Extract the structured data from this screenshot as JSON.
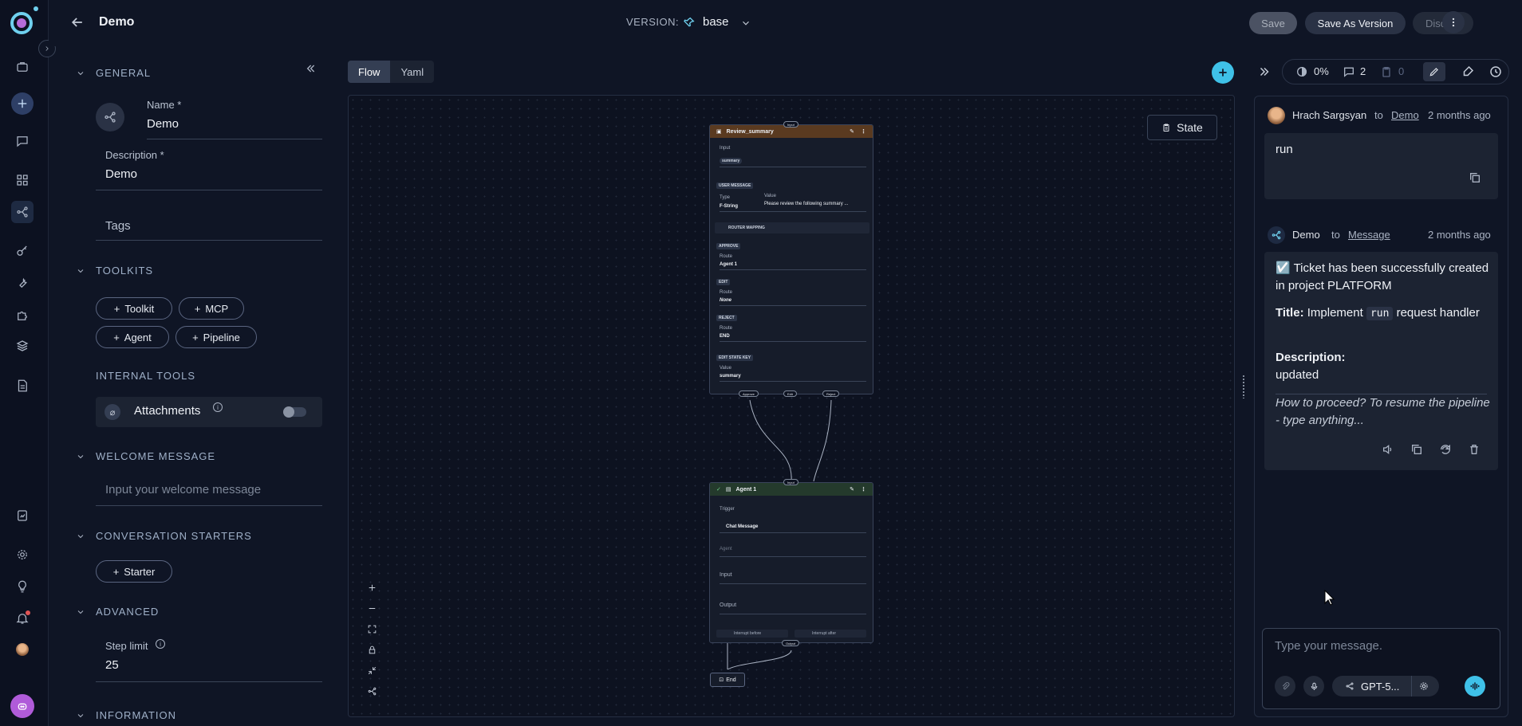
{
  "header": {
    "title": "Demo",
    "version_label": "VERSION:",
    "version_value": "base",
    "save_label": "Save",
    "save_as_version_label": "Save As Version",
    "discard_label": "Discard"
  },
  "left_panel": {
    "general": {
      "heading": "GENERAL",
      "name_label": "Name *",
      "name_value": "Demo",
      "description_label": "Description *",
      "description_value": "Demo",
      "tags_placeholder": "Tags"
    },
    "toolkits": {
      "heading": "TOOLKITS",
      "buttons": [
        "Toolkit",
        "MCP",
        "Agent",
        "Pipeline"
      ]
    },
    "internal_tools": {
      "heading": "INTERNAL TOOLS",
      "attachments_label": "Attachments",
      "attachments_enabled": false
    },
    "welcome_message": {
      "heading": "WELCOME MESSAGE",
      "placeholder": "Input your welcome message"
    },
    "conversation_starters": {
      "heading": "CONVERSATION STARTERS",
      "button": "Starter"
    },
    "advanced": {
      "heading": "ADVANCED",
      "step_limit_label": "Step limit",
      "step_limit_value": "25"
    },
    "information": {
      "heading": "INFORMATION"
    }
  },
  "canvas": {
    "tabs": [
      "Flow",
      "Yaml"
    ],
    "active_tab": "Flow",
    "state_button": "State",
    "nodes": {
      "review": {
        "title": "Review_summary",
        "input_port": "Input",
        "input_label": "Input",
        "input_chip": "summary",
        "user_message_badge": "USER MESSAGE",
        "type_label": "Type",
        "type_value": "F-String",
        "value_label": "Value",
        "value_text": "Please review the following summary ...",
        "router_mapping": "ROUTER MAPPING",
        "approve_badge": "APPROVE",
        "approve_route_label": "Route",
        "approve_route": "Agent 1",
        "edit_badge": "EDIT",
        "edit_route_label": "Route",
        "edit_route": "None",
        "reject_badge": "REJECT",
        "reject_route_label": "Route",
        "reject_route": "END",
        "edit_state_key_badge": "EDIT STATE KEY",
        "edit_state_value_label": "Value",
        "edit_state_value": "summary",
        "ports_out": [
          "Approve",
          "Edit",
          "Reject"
        ]
      },
      "agent": {
        "title": "Agent 1",
        "input_port": "Input",
        "trigger_label": "Trigger",
        "trigger_value": "Chat Message",
        "agent_placeholder": "Agent",
        "input_field": "Input",
        "output_field": "Output",
        "interrupt_before": "Interrupt before",
        "interrupt_after": "Interrupt after",
        "output_port": "Output"
      },
      "end": {
        "title": "End"
      }
    }
  },
  "toolbar_right": {
    "progress": "0%",
    "comments": "2",
    "tasks": "0"
  },
  "chat": {
    "messages": [
      {
        "author": "Hrach Sargsyan",
        "to": "to",
        "target": "Demo",
        "time": "2 months ago",
        "text": "run"
      },
      {
        "author": "Demo",
        "to": "to",
        "target": "Message",
        "time": "2 months ago",
        "line1": "☑️ Ticket has been successfully created in project PLATFORM",
        "title_label": "Title:",
        "title_pre": "Implement",
        "title_code": "run",
        "title_post": "request handler",
        "desc_label": "Description:",
        "desc_value": "updated",
        "proceed": "How to proceed? To resume the pipeline - type anything..."
      }
    ],
    "input_placeholder": "Type your message.",
    "model": "GPT-5..."
  },
  "colors": {
    "background": "#0f1525",
    "accent": "#3fc1e8",
    "review_header": "#5a3a20",
    "agent_header": "#243a2c"
  }
}
